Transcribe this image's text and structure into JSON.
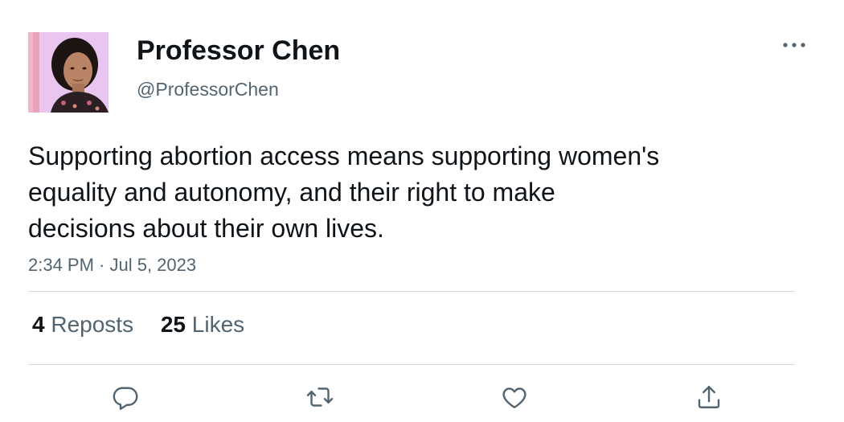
{
  "author": {
    "display_name": "Professor Chen",
    "handle": "@ProfessorChen",
    "avatar": "profile-photo"
  },
  "tweet": {
    "text": "Supporting abortion access means supporting women's\nequality and autonomy, and their right to make\ndecisions about their own lives.",
    "timestamp": "2:34 PM · Jul 5, 2023"
  },
  "stats": {
    "reposts_count": "4",
    "reposts_label": "Reposts",
    "likes_count": "25",
    "likes_label": "Likes"
  },
  "actions": [
    {
      "name": "reply",
      "icon": "reply-icon"
    },
    {
      "name": "repost",
      "icon": "repost-icon"
    },
    {
      "name": "like",
      "icon": "heart-icon"
    },
    {
      "name": "share",
      "icon": "share-icon"
    }
  ],
  "colors": {
    "text_primary": "#0f1419",
    "text_secondary": "#536471",
    "divider": "#cfd9de"
  }
}
